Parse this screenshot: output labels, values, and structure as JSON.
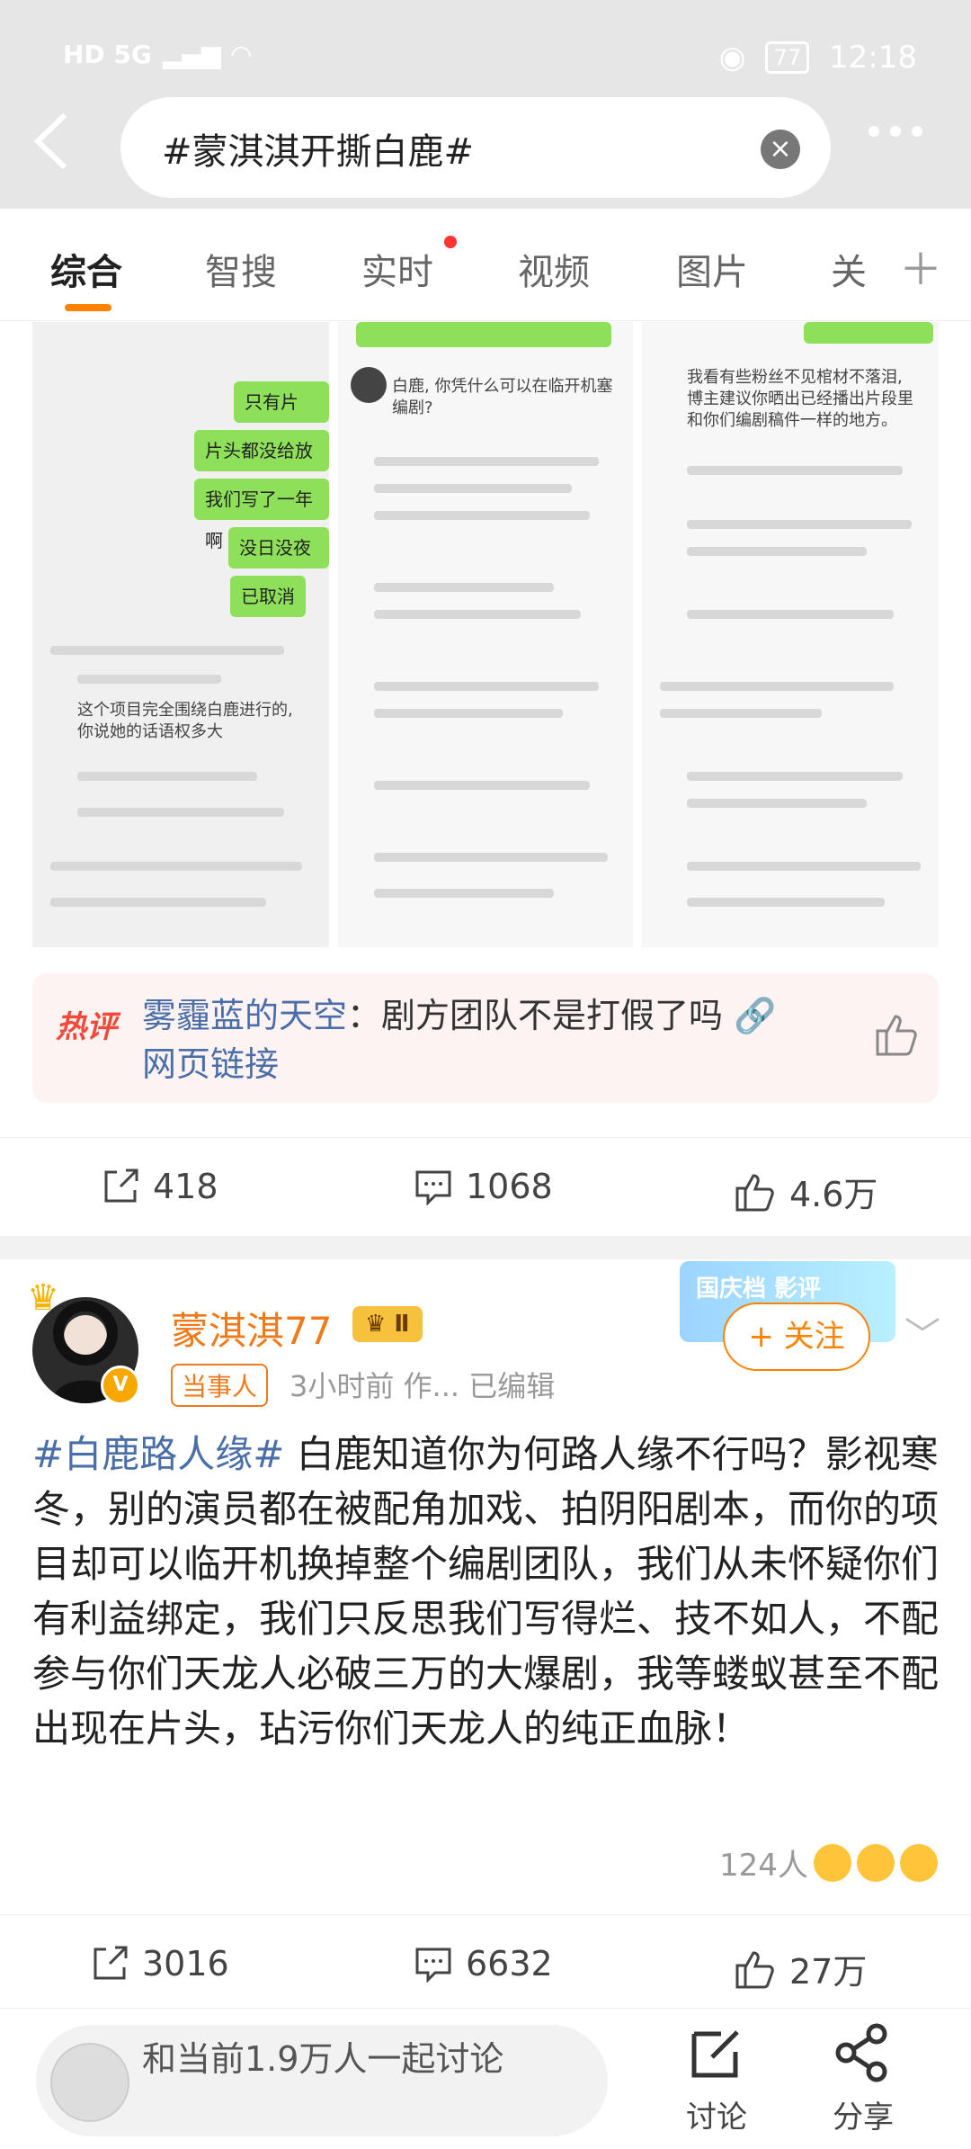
{
  "status_bar": {
    "left": "HD  5G",
    "battery": "77",
    "time": "12:18"
  },
  "search": {
    "query": "#蒙淇淇开撕白鹿#"
  },
  "tabs": [
    "综合",
    "智搜",
    "实时",
    "视频",
    "图片",
    "关"
  ],
  "images": {
    "thumb1_bubbles": [
      "只有片尾?",
      "片头都没给放吗",
      "我们写了一年啊",
      "没日没夜的",
      "已取消"
    ],
    "thumb1_comment": "这个项目完全围绕白鹿进行的, 你说她的话语权多大",
    "thumb2_comment": "白鹿, 你凭什么可以在临开机塞编剧?",
    "thumb3_comment": "我看有些粉丝不见棺材不落泪, 博主建议你晒出已经播出片段里和你们编剧稿件一样的地方。"
  },
  "hot_comment": {
    "tag": "热评",
    "user": "雾霾蓝的天空",
    "text": "剧方团队不是打假了吗",
    "link": "网页链接"
  },
  "post1_actions": {
    "reposts": "418",
    "comments": "1068",
    "likes": "4.6万"
  },
  "post": {
    "username": "蒙淇淇77",
    "level": "Ⅱ",
    "role_tag": "当事人",
    "meta": "3小时前   作...   已编辑",
    "follow": "+ 关注",
    "promo": "国庆档 影评",
    "hashtag": "#白鹿路人缘#",
    "text": " 白鹿知道你为何路人缘不行吗？影视寒冬，别的演员都在被配角加戏、拍阴阳剧本，而你的项目却可以临开机换掉整个编剧团队，我们从未怀疑你们有利益绑定，我们只反思我们写得烂、技不如人，不配参与你们天龙人必破三万的大爆剧，我等蝼蚁甚至不配出现在片头，玷污你们天龙人的纯正血脉！",
    "reaction_count": "124人"
  },
  "post2_actions": {
    "reposts": "3016",
    "comments": "6632",
    "likes": "27万"
  },
  "bottom": {
    "placeholder": "和当前1.9万人一起讨论",
    "discuss": "讨论",
    "share": "分享"
  }
}
